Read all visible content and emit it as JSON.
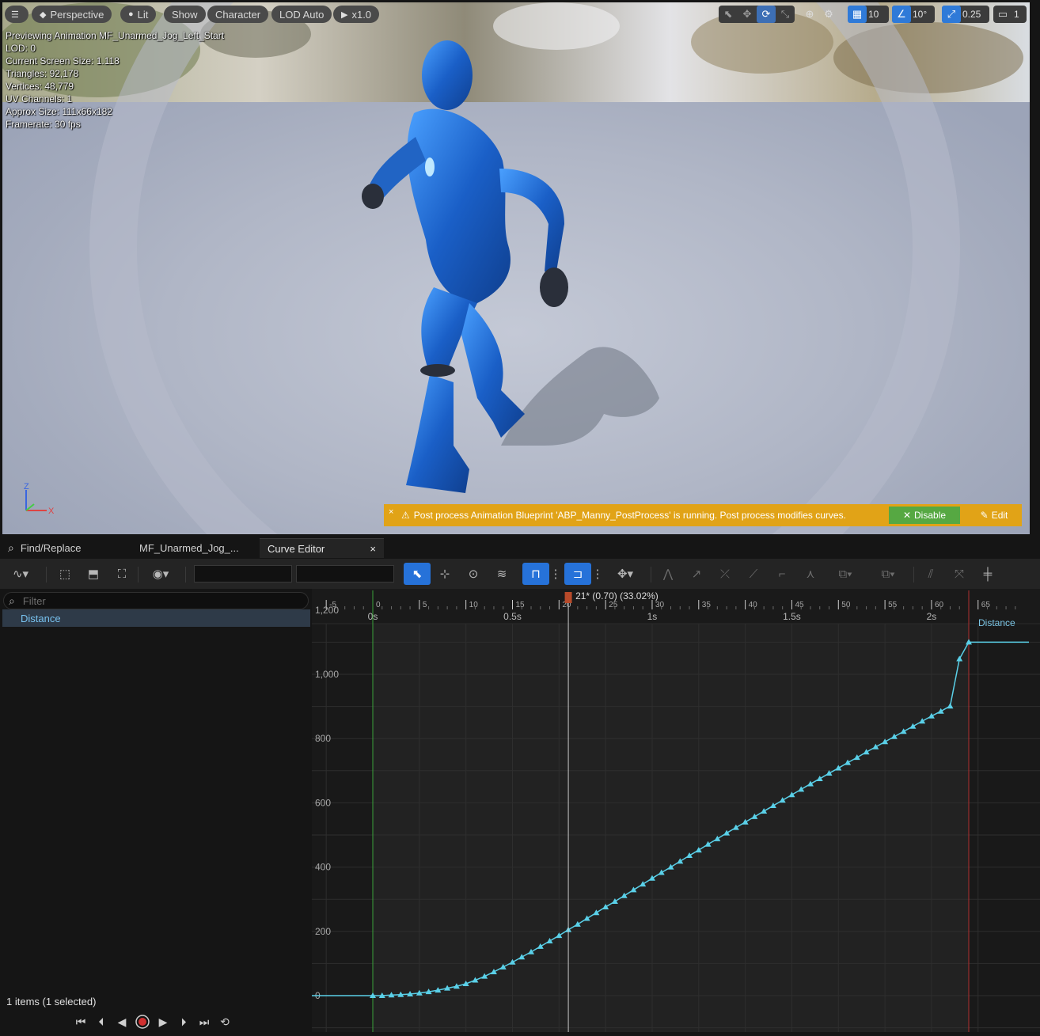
{
  "viewport": {
    "toolbar": {
      "menu_icon": "hamburger-icon",
      "perspective": "Perspective",
      "lit": "Lit",
      "show": "Show",
      "character": "Character",
      "lod": "LOD Auto",
      "play_rate": "x1.0",
      "grid_snap": "10",
      "rotation_snap": "10°",
      "scale_snap": "0.25",
      "camera_speed": "1"
    },
    "stats": [
      "Previewing Animation MF_Unarmed_Jog_Left_Start",
      "LOD: 0",
      "Current Screen Size: 1.118",
      "Triangles: 92,178",
      "Vertices: 48,779",
      "UV Channels: 1",
      "Approx Size: 111x66x182",
      "Framerate: 30 fps"
    ],
    "axis": {
      "z": "Z",
      "x": "X"
    },
    "banner": {
      "close": "×",
      "message": "Post process Animation Blueprint 'ABP_Manny_PostProcess' is running. Post process modifies curves.",
      "disable_label": "Disable",
      "edit_label": "Edit",
      "color": "#e1a317"
    }
  },
  "tabs": {
    "find_replace": "Find/Replace",
    "animation": "MF_Unarmed_Jog_...",
    "curve_editor": "Curve Editor",
    "close": "×"
  },
  "left_panel": {
    "filter_placeholder": "Filter",
    "curve_item": "Distance",
    "status": "1 items (1 selected)"
  },
  "graph": {
    "playhead_label": "21* (0.70) (33.02%)",
    "curve_label": "Distance",
    "frame_ticks": [
      "-5",
      "0",
      "5",
      "10",
      "15",
      "20",
      "25",
      "30",
      "35",
      "40",
      "45",
      "50",
      "55",
      "60",
      "65"
    ],
    "time_ticks": [
      "0s",
      "0.5s",
      "1s",
      "1.5s",
      "2s"
    ],
    "value_ticks": [
      "1,200",
      "1,000",
      "800",
      "600",
      "400",
      "200",
      "0"
    ],
    "curve_color": "#5ad0e8"
  },
  "chart_data": {
    "type": "line",
    "title": "",
    "xlabel": "",
    "ylabel": "",
    "series": [
      {
        "name": "Distance",
        "x": [
          0,
          1,
          2,
          3,
          4,
          5,
          6,
          7,
          8,
          9,
          10,
          11,
          12,
          13,
          14,
          15,
          16,
          17,
          18,
          19,
          20,
          21,
          22,
          23,
          24,
          25,
          26,
          27,
          28,
          29,
          30,
          31,
          32,
          33,
          34,
          35,
          36,
          37,
          38,
          39,
          40,
          41,
          42,
          43,
          44,
          45,
          46,
          47,
          48,
          49,
          50,
          51,
          52,
          53,
          54,
          55,
          56,
          57,
          58,
          59,
          60,
          61,
          62,
          63,
          64
        ],
        "values": [
          0,
          0,
          2,
          3,
          5,
          8,
          12,
          17,
          23,
          29,
          37,
          48,
          60,
          74,
          89,
          104,
          120,
          136,
          153,
          170,
          187,
          205,
          222,
          240,
          258,
          276,
          293,
          311,
          329,
          347,
          365,
          383,
          400,
          418,
          436,
          453,
          471,
          488,
          506,
          523,
          540,
          557,
          574,
          591,
          608,
          625,
          642,
          659,
          675,
          692,
          708,
          725,
          741,
          758,
          774,
          790,
          806,
          822,
          838,
          854,
          870,
          885,
          901,
          1048,
          1100
        ]
      }
    ],
    "xlim": [
      -7,
      70
    ],
    "ylim": [
      -40,
      1220
    ],
    "x_range_start_frame": 0,
    "x_range_end_frame": 64,
    "playhead_frame": 21
  },
  "transport": {
    "icons": [
      "skip-to-start-icon",
      "step-back-icon",
      "play-reverse-icon",
      "record-icon",
      "play-icon",
      "step-forward-icon",
      "skip-to-end-icon",
      "loop-icon"
    ]
  }
}
